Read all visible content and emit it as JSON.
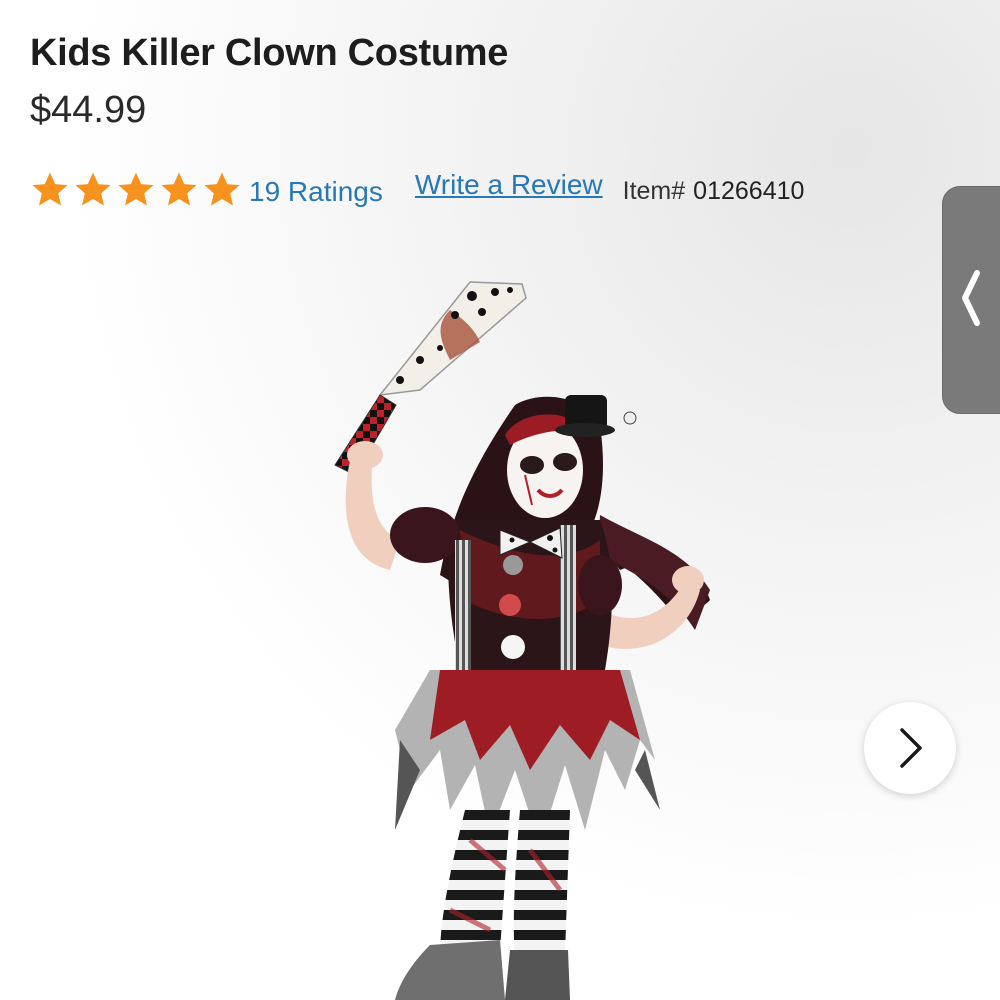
{
  "product": {
    "title": "Kids Killer Clown Costume",
    "price": "$44.99"
  },
  "rating": {
    "stars": 5,
    "star_color": "#f7921e",
    "ratings_text": "19 Ratings",
    "write_review": "Write a Review"
  },
  "item": {
    "label": "Item#",
    "number": "01266410"
  },
  "icons": {
    "side_tab": "chevron-left-icon",
    "next": "chevron-right-icon"
  },
  "colors": {
    "link": "#2778b7",
    "tab": "#7a7a7a"
  }
}
